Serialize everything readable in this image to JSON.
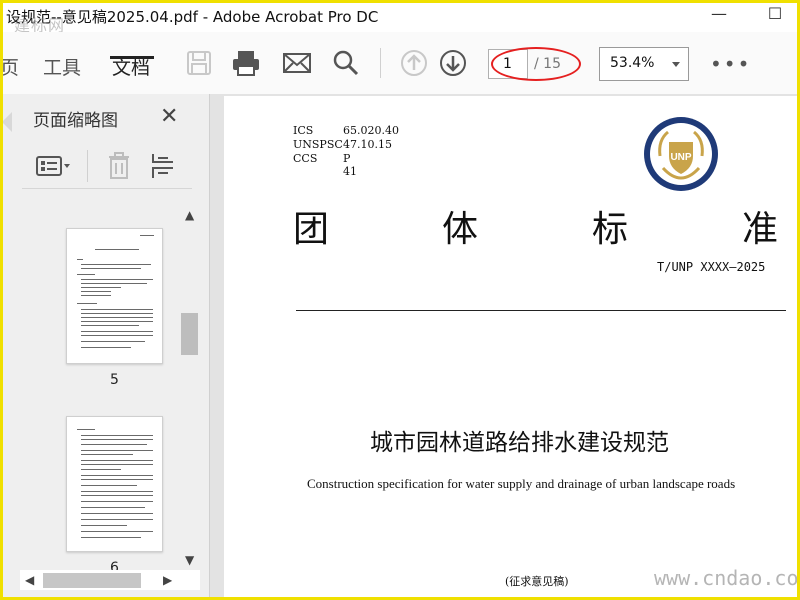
{
  "window": {
    "title": "设规范--意见稿2025.04.pdf - Adobe Acrobat Pro DC",
    "overlay_text": "建标网",
    "minimize": "—",
    "maximize": "☐"
  },
  "toolbar": {
    "tabs": [
      {
        "label": "页"
      },
      {
        "label": "工具"
      },
      {
        "label": "文档"
      }
    ],
    "active_tab": "文档",
    "page_current": "1",
    "page_total": "/ 15",
    "zoom": "53.4%",
    "more": "•••",
    "icons": [
      "save-icon",
      "print-icon",
      "mail-icon",
      "search-icon",
      "prev-page-icon",
      "next-page-icon"
    ]
  },
  "thumbnail_panel": {
    "title": "页面缩略图",
    "close": "✕",
    "pages": [
      {
        "number": "5"
      },
      {
        "number": "6"
      }
    ]
  },
  "document": {
    "meta": [
      {
        "key": "ICS",
        "value": "65.020.40"
      },
      {
        "key": "UNSPSC",
        "value": "47.10.15"
      },
      {
        "key": "CCS",
        "value": "P 41"
      }
    ],
    "logo_text": "UNP",
    "heading_chars": [
      "团",
      "体",
      "标",
      "准"
    ],
    "standard_no": "T/UNP XXXX—2025",
    "title": "城市园林道路给排水建设规范",
    "subtitle": "Construction specification for water supply and drainage of urban landscape roads",
    "draft_label": "(征求意见稿)",
    "watermark": "www.cndao.com"
  },
  "colors": {
    "annotation": "#e52020",
    "frame": "#f0e000",
    "logo_ring": "#1f3a78",
    "logo_gold": "#c9a44a"
  }
}
